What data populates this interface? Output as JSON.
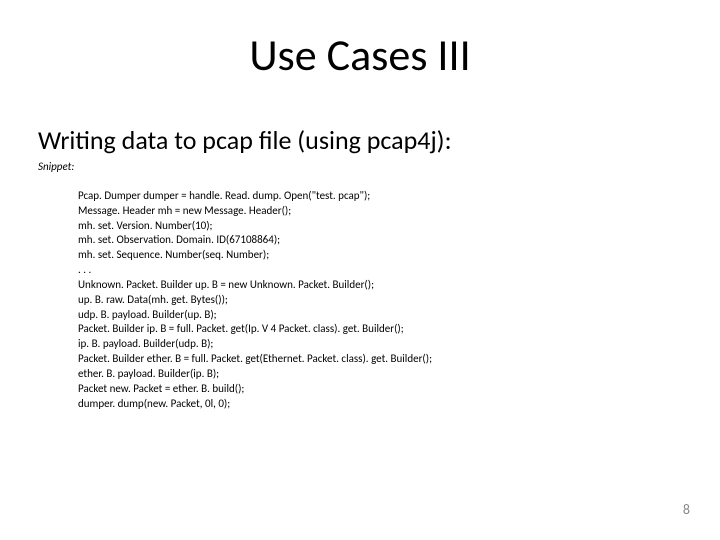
{
  "title": "Use Cases III",
  "subtitle": "Writing data to pcap file (using pcap4j):",
  "snippet_label": "Snippet:",
  "code": {
    "l1": "Pcap. Dumper dumper = handle. Read. dump. Open(\"test. pcap\");",
    "l2": "Message. Header mh = new Message. Header();",
    "l3": "mh. set. Version. Number(10);",
    "l4": "mh. set. Observation. Domain. ID(67108864);",
    "l5": "mh. set. Sequence. Number(seq. Number);",
    "l6": ". . .",
    "l7": "Unknown. Packet. Builder up. B = new Unknown. Packet. Builder();",
    "l8": "up. B. raw. Data(mh. get. Bytes());",
    "l9": "udp. B. payload. Builder(up. B);",
    "l10": "Packet. Builder ip. B = full. Packet. get(Ip. V 4 Packet. class). get. Builder();",
    "l11": "ip. B. payload. Builder(udp. B);",
    "l12": "Packet. Builder ether. B = full. Packet. get(Ethernet. Packet. class). get. Builder();",
    "l13": "ether. B. payload. Builder(ip. B);",
    "l14": "Packet new. Packet = ether. B. build();",
    "l15": "dumper. dump(new. Packet, 0l, 0);"
  },
  "page_number": "8"
}
